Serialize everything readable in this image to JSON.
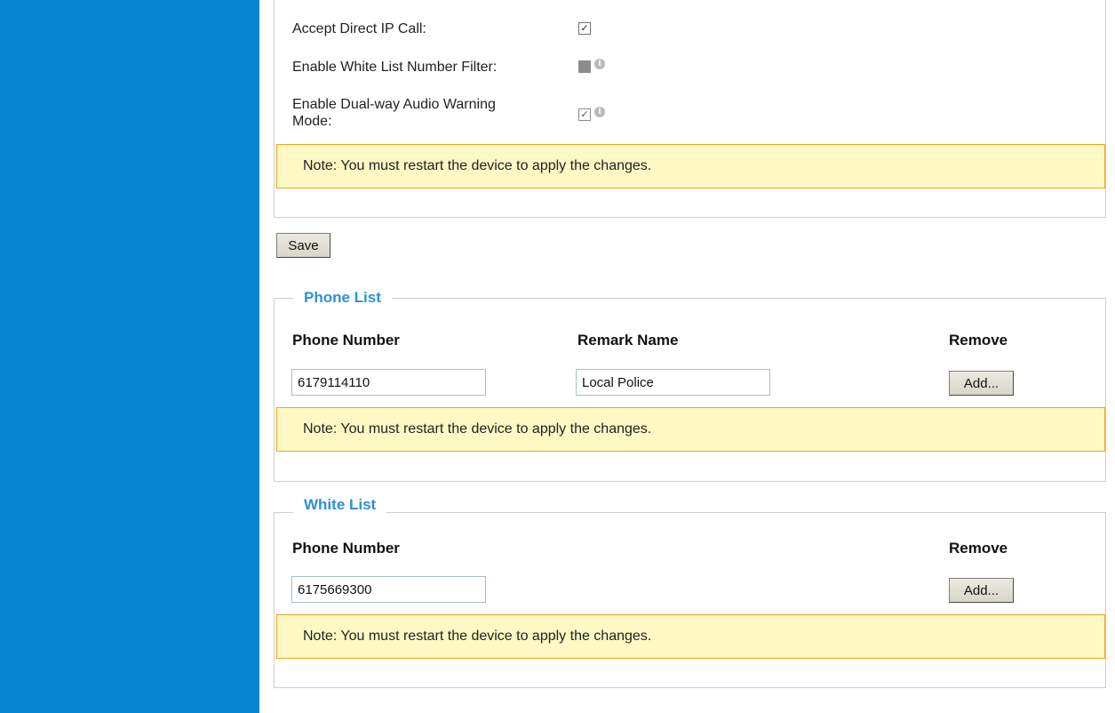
{
  "settings": {
    "accept_direct_ip_call": {
      "label": "Accept Direct IP Call:",
      "checked": true,
      "enabled": true
    },
    "white_list_filter": {
      "label": "Enable White List Number Filter:",
      "checked": false,
      "enabled": false,
      "info_icon": "info-icon"
    },
    "dual_way_audio": {
      "label_line1": "Enable Dual-way Audio Warning",
      "label_line2": "Mode:",
      "checked": true,
      "enabled": false,
      "info_icon": "info-icon"
    },
    "note": "Note: You must restart the device to apply the changes."
  },
  "save_button": "Save",
  "phone_list": {
    "title": "Phone List",
    "columns": {
      "phone": "Phone Number",
      "remark": "Remark Name",
      "remove": "Remove"
    },
    "row": {
      "phone": "6179114110",
      "remark": "Local Police"
    },
    "add_button": "Add...",
    "note": "Note: You must restart the device to apply the changes."
  },
  "white_list": {
    "title": "White List",
    "columns": {
      "phone": "Phone Number",
      "remove": "Remove"
    },
    "row": {
      "phone": "6175669300"
    },
    "add_button": "Add...",
    "note": "Note: You must restart the device to apply the changes."
  },
  "colors": {
    "sidebar": "#0685d3",
    "legend": "#2d8fd5",
    "note_bg": "#fdf8c4",
    "note_border": "#f0a21f"
  }
}
